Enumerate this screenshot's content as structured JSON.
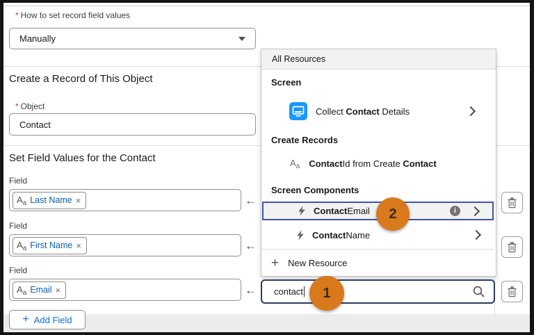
{
  "form": {
    "required_marker": "*",
    "how_to_label": "How to set record field values",
    "how_to_value": "Manually",
    "create_heading": "Create a Record of This Object",
    "object_label": "Object",
    "object_value": "Contact",
    "set_values_heading": "Set Field Values for the Contact",
    "field_rows": [
      {
        "label": "Field",
        "pill": "Last Name"
      },
      {
        "label": "Field",
        "pill": "First Name"
      },
      {
        "label": "Field",
        "pill": "Email"
      }
    ],
    "add_field_label": "Add Field"
  },
  "picker": {
    "header": "All Resources",
    "screen_section": "Screen",
    "screen_item": {
      "pre": "Collect ",
      "bold": "Contact",
      "post": " Details"
    },
    "create_section": "Create Records",
    "create_item": {
      "bold1": "Contact",
      "mid": "Id from Create ",
      "bold2": "Contact"
    },
    "components_section": "Screen Components",
    "component_items": [
      {
        "bold": "Contact",
        "rest": "Email"
      },
      {
        "bold": "Contact",
        "rest": "Name"
      }
    ],
    "new_resource_label": "New Resource",
    "search_value": "contact"
  },
  "annotations": {
    "step1": "1",
    "step2": "2"
  },
  "icons": {
    "remove": "×",
    "left_arrow": "←",
    "plus": "+",
    "info": "i",
    "aa_big": "A",
    "aa_small": "a"
  },
  "colors": {
    "accent_orange": "#d8791c",
    "selected_border": "#3c55a5",
    "focus_border": "#2a3a63",
    "link_blue": "#0b5cab",
    "screen_icon_blue": "#1b96ff"
  }
}
